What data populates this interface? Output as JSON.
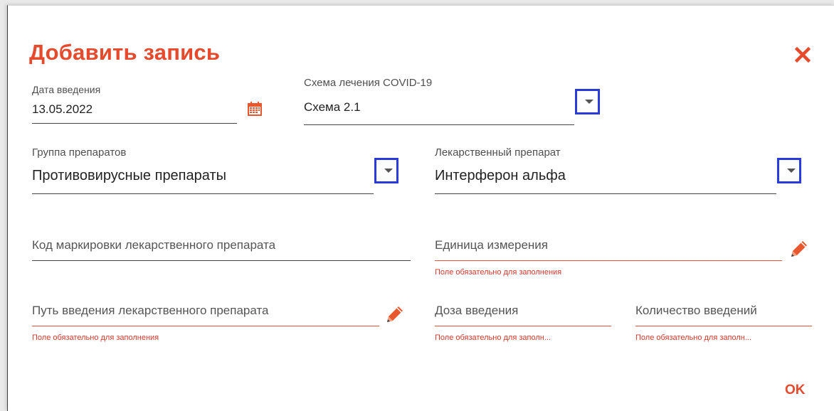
{
  "dialog": {
    "title": "Добавить запись",
    "ok_label": "OK"
  },
  "fields": {
    "date": {
      "label": "Дата введения",
      "value": "13.05.2022"
    },
    "scheme": {
      "label": "Схема лечения COVID-19",
      "value": "Схема 2.1"
    },
    "group": {
      "label": "Группа препаратов",
      "value": "Противовирусные препараты"
    },
    "drug": {
      "label": "Лекарственный препарат",
      "value": "Интерферон альфа"
    },
    "marking_code": {
      "placeholder": "Код маркировки лекарственного препарата"
    },
    "unit": {
      "placeholder": "Единица измерения",
      "error": "Поле обязательно для заполнения"
    },
    "route": {
      "placeholder": "Путь введения лекарственного препарата",
      "error": "Поле обязательно для заполнения"
    },
    "dose": {
      "placeholder": "Доза введения",
      "error": "Поле обязательно для заполн..."
    },
    "count": {
      "placeholder": "Количество введений",
      "error": "Поле обязательно для заполн..."
    }
  },
  "colors": {
    "accent": "#e54a2d",
    "error": "#d33a2c",
    "focus_border": "#2a3cd8"
  }
}
